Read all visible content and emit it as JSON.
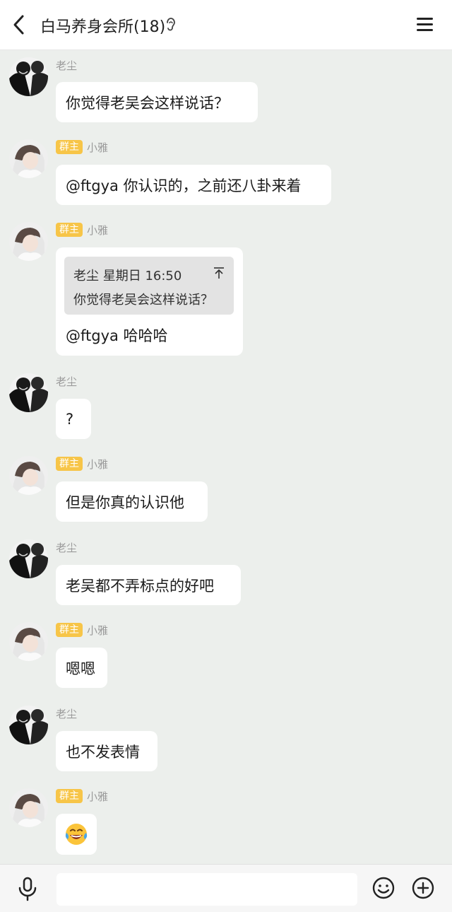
{
  "header": {
    "title": "白马养身会所(18)",
    "back_icon": "chevron-left-icon",
    "ear_icon": "ear-icon",
    "menu_icon": "hamburger-menu-icon"
  },
  "messages": [
    {
      "sender": "老尘",
      "role": "",
      "text": "你觉得老吴会这样说话？"
    },
    {
      "sender": "小雅",
      "role": "群主",
      "text": "@ftgya 你认识的，之前还八卦来着"
    },
    {
      "sender": "小雅",
      "role": "群主",
      "quote": {
        "meta": "老尘  星期日 16:50",
        "text": "你觉得老吴会这样说话？"
      },
      "text": "@ftgya 哈哈哈"
    },
    {
      "sender": "老尘",
      "role": "",
      "text": "?"
    },
    {
      "sender": "小雅",
      "role": "群主",
      "text": "但是你真的认识他"
    },
    {
      "sender": "老尘",
      "role": "",
      "text": "老吴都不弄标点的好吧"
    },
    {
      "sender": "小雅",
      "role": "群主",
      "text": "嗯嗯"
    },
    {
      "sender": "老尘",
      "role": "",
      "text": "也不发表情"
    },
    {
      "sender": "小雅",
      "role": "群主",
      "text": "",
      "emoji": "laughing-tears-emoji"
    }
  ],
  "input_bar": {
    "mic_icon": "microphone-icon",
    "emoji_icon": "smiley-icon",
    "plus_icon": "plus-circle-icon",
    "placeholder": ""
  },
  "colors": {
    "background": "#ecefec",
    "bubble": "#ffffff",
    "badge": "#f7c548",
    "name": "#9a9a9a"
  }
}
